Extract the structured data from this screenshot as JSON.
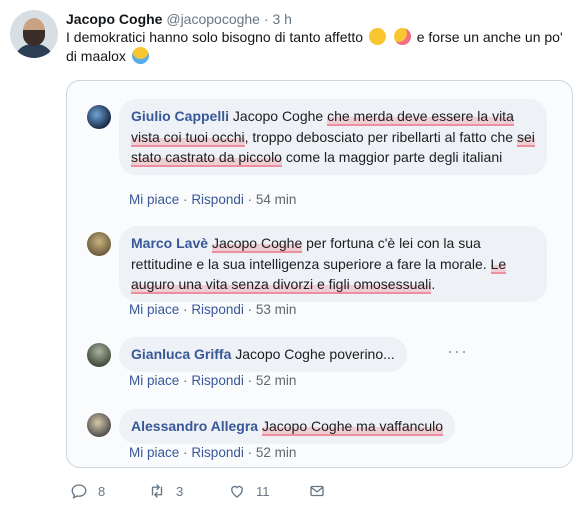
{
  "tweet": {
    "author_name": "Jacopo Coghe",
    "handle": "@jacopocoghe",
    "dot": "·",
    "time": "3 h",
    "text_part1": "I demokratici hanno solo bisogno di tanto affetto",
    "text_part2": "e forse un anche un po' di maalox",
    "emojis": [
      "hugging-face",
      "kissing-face",
      "rolling-laughing-face"
    ]
  },
  "comments": [
    {
      "author": "Giulio Cappelli",
      "text_a": "Jacopo Coghe ",
      "hl_1": "che merda deve essere la vita vista coi tuoi occhi",
      "text_b": ", troppo debosciato per ribellarti al fatto che ",
      "hl_2": "sei stato castrato da piccolo",
      "text_c": " come la maggior parte degli italiani",
      "like": "Mi piace",
      "reply": "Rispondi",
      "sep": "·",
      "ago": "54 min"
    },
    {
      "author": "Marco Lavè",
      "hl_1": "Jacopo Coghe",
      "text_b": " per fortuna c'è lei con la sua rettitudine e la sua intelligenza superiore a fare la morale. ",
      "hl_2": "Le auguro una vita senza divorzi e figli omosessuali",
      "text_c": ".",
      "like": "Mi piace",
      "reply": "Rispondi",
      "sep": "·",
      "ago": "53 min"
    },
    {
      "author": "Gianluca Griffa",
      "text_a": "Jacopo Coghe poverino...",
      "more": "···",
      "like": "Mi piace",
      "reply": "Rispondi",
      "sep": "·",
      "ago": "52 min"
    },
    {
      "author": "Alessandro Allegra",
      "hl_1": "Jacopo Coghe ma vaffanculo",
      "like": "Mi piace",
      "reply": "Rispondi",
      "sep": "·",
      "ago": "52 min"
    }
  ],
  "footer": {
    "replies": "8",
    "retweets": "3",
    "likes": "11"
  },
  "colors": {
    "facebook_link": "#385898",
    "bubble": "#eef1f5",
    "highlight": "#eb6e82",
    "twitter_gray": "#657786"
  }
}
